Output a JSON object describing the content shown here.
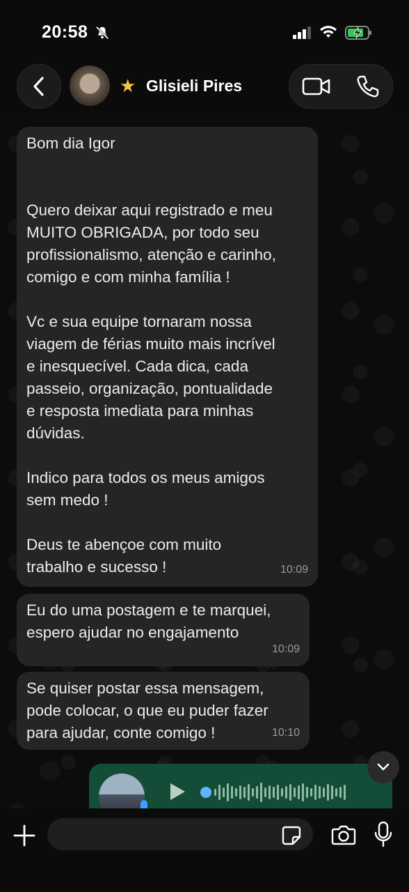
{
  "status_bar": {
    "time": "20:58"
  },
  "header": {
    "contact_name": "Glisieli Pires"
  },
  "messages": [
    {
      "text": "Bom dia Igor\n\n\nQuero deixar aqui registrado e meu\nMUITO OBRIGADA, por todo seu\nprofissionalismo, atenção e carinho,\ncomigo e com minha família !\n\nVc e sua equipe tornaram nossa\nviagem de férias muito mais incrível\ne inesquecível. Cada dica, cada\npasseio, organização, pontualidade\ne resposta imediata para minhas\ndúvidas.\n\nIndico para todos os meus amigos\nsem medo !\n\nDeus te abençoe com muito\ntrabalho e sucesso !",
      "time": "10:09"
    },
    {
      "text": "Eu do uma postagem e te marquei,\nespero ajudar no engajamento",
      "time": "10:09"
    },
    {
      "text": "Se quiser postar essa mensagem,\npode colocar, o que eu puder fazer\npara ajudar, conte comigo !",
      "time": "10:10"
    }
  ],
  "composer": {
    "input_value": ""
  },
  "colors": {
    "accent": "#144d37",
    "bubble": "#242526",
    "star": "#f5c342"
  },
  "icons": [
    "bell-slash-icon",
    "signal-icon",
    "wifi-icon",
    "battery-charging-icon",
    "back-icon",
    "star-icon",
    "video-call-icon",
    "phone-icon",
    "play-icon",
    "chevron-down-icon",
    "plus-icon",
    "sticker-icon",
    "camera-icon",
    "microphone-icon"
  ]
}
